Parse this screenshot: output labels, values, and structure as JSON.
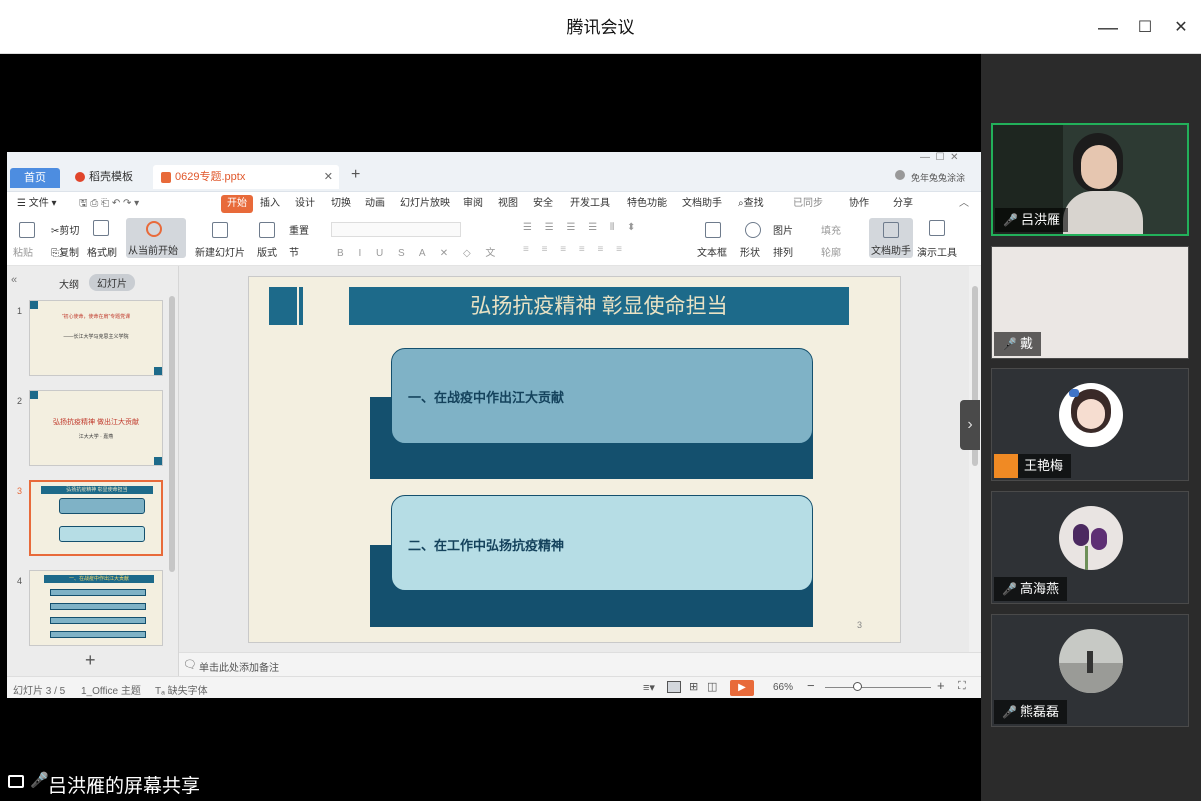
{
  "app": {
    "title": "腾讯会议"
  },
  "window_controls": {
    "minimize": "—",
    "maximize": "☐",
    "close": "✕"
  },
  "wps": {
    "tabs": [
      "首页",
      "稻壳模板",
      "0629专题.pptx"
    ],
    "ribbon_tabs": [
      "开始",
      "插入",
      "设计",
      "切换",
      "动画",
      "幻灯片放映",
      "审阅",
      "视图",
      "安全",
      "开发工具",
      "特色功能",
      "文档助手",
      "查找",
      "已同步",
      "协作",
      "分享"
    ],
    "file_menu": "文件",
    "user_label": "免年兔兔涂涂",
    "tools": {
      "cut": "剪切",
      "paste": "粘贴",
      "copy": "复制",
      "format_painter": "格式刷",
      "from_current": "从当前开始",
      "new_slide": "新建幻灯片",
      "layout": "版式",
      "section": "节",
      "reset": "重置",
      "textbox": "文本框",
      "shape": "形状",
      "arrange": "排列",
      "picture": "图片",
      "fill": "填充",
      "outline": "轮廓",
      "doc_assistant": "文档助手",
      "presentation_tools": "演示工具"
    },
    "pane_tabs": [
      "大纲",
      "幻灯片"
    ],
    "thumbs": [
      {
        "num": "1",
        "title": "“初心使命，使命在肩”专题党课",
        "subtitle": "——长江大学马克思主义学院"
      },
      {
        "num": "2",
        "title": "弘扬抗疫精神 做出江大贡献",
        "subtitle": "江大大学 · 嘉燕"
      },
      {
        "num": "3",
        "title": "弘扬抗疫精神 彰显使命担当",
        "subtitle": ""
      },
      {
        "num": "4",
        "title": "一、在战疫中作出江大贡献",
        "subtitle": ""
      }
    ],
    "slide": {
      "title": "弘扬抗疫精神 彰显使命担当",
      "item1": "一、在战疫中作出江大贡献",
      "item2": "二、在工作中弘扬抗疫精神",
      "page": "3"
    },
    "notes_placeholder": "单击此处添加备注",
    "status": {
      "slide_count": "幻灯片 3 / 5",
      "theme": "1_Office 主题",
      "missing_font": "缺失字体",
      "zoom": "66%"
    }
  },
  "participants": [
    {
      "name": "吕洪雁",
      "mic": "on"
    },
    {
      "name": "戴",
      "mic": "muted"
    },
    {
      "name": "王艳梅",
      "mic": "none"
    },
    {
      "name": "高海燕",
      "mic": "muted"
    },
    {
      "name": "熊磊磊",
      "mic": "muted"
    }
  ],
  "share_label": "吕洪雁的屏幕共享",
  "colors": {
    "slide_title_bar": "#1d6a8a",
    "slide_title_text": "#e9e2c4",
    "box_dark": "#14506e",
    "box1": "#7fb2c6",
    "box2": "#b6dde5",
    "brand_orange": "#e86a3a",
    "tab_blue": "#4d8de0"
  }
}
